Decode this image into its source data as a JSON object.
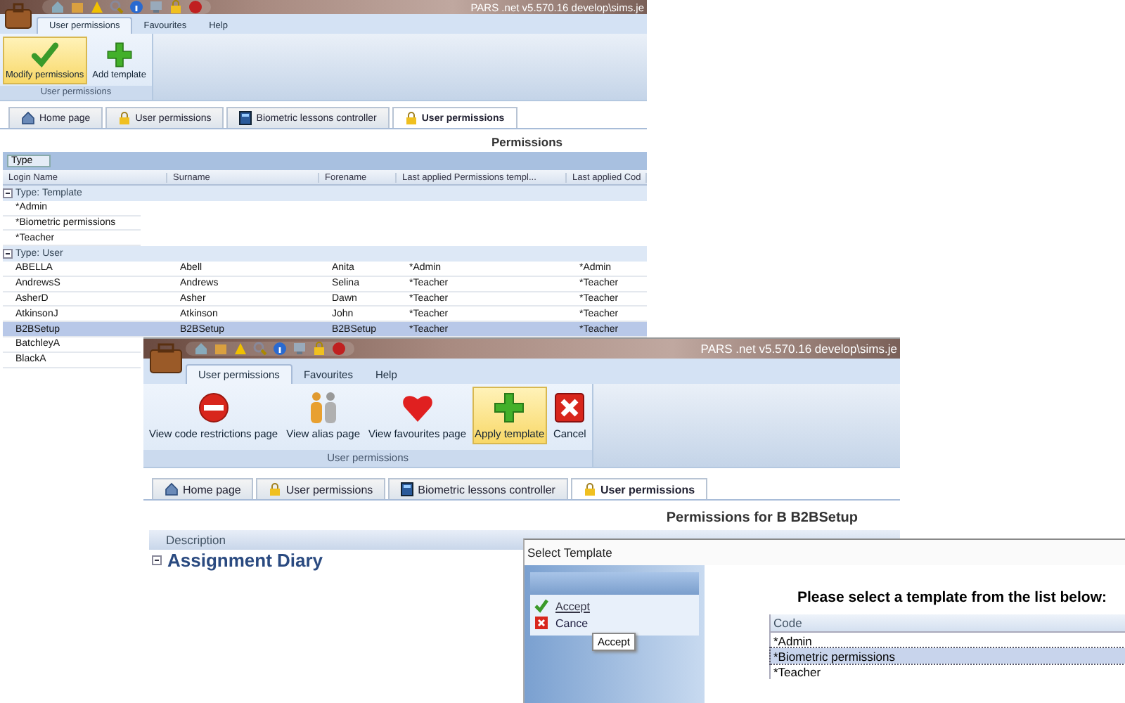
{
  "permissions_window": {
    "title": "PARS .net v5.570.16  develop\\sims.je",
    "ribbon_tabs": [
      {
        "label": "User permissions",
        "selected": true
      },
      {
        "label": "Favourites",
        "selected": false
      },
      {
        "label": "Help",
        "selected": false
      }
    ],
    "ribbon_buttons": [
      {
        "label": "Modify permissions",
        "kind": "check",
        "highlighted": true
      },
      {
        "label": "Add template",
        "kind": "plus",
        "highlighted": false
      }
    ],
    "ribbon_group_label": "User permissions",
    "document_tabs": [
      {
        "label": "Home page",
        "kind": "home",
        "selected": false
      },
      {
        "label": "User permissions",
        "kind": "lock",
        "selected": false
      },
      {
        "label": "Biometric lessons controller",
        "kind": "book",
        "selected": false
      },
      {
        "label": "User permissions",
        "kind": "lock",
        "selected": true
      }
    ],
    "heading": "Permissions",
    "group_by": "Type",
    "table": {
      "columns": [
        "Login Name",
        "Surname",
        "Forename",
        "Last applied Permissions templ...",
        "Last applied Cod"
      ],
      "groups": [
        {
          "label": "Type: Template",
          "expanded": true,
          "rows": [
            {
              "cells": [
                "*Admin"
              ],
              "selected": false
            },
            {
              "cells": [
                "*Biometric permissions"
              ],
              "selected": false
            },
            {
              "cells": [
                "*Teacher"
              ],
              "selected": false
            }
          ]
        },
        {
          "label": "Type: User",
          "expanded": true,
          "rows": [
            {
              "cells": [
                "ABELLA",
                "Abell",
                "Anita",
                "*Admin",
                "*Admin"
              ],
              "selected": false
            },
            {
              "cells": [
                "AndrewsS",
                "Andrews",
                "Selina",
                "*Teacher",
                "*Teacher"
              ],
              "selected": false
            },
            {
              "cells": [
                "AsherD",
                "Asher",
                "Dawn",
                "*Teacher",
                "*Teacher"
              ],
              "selected": false
            },
            {
              "cells": [
                "AtkinsonJ",
                "Atkinson",
                "John",
                "*Teacher",
                "*Teacher"
              ],
              "selected": false
            },
            {
              "cells": [
                "B2BSetup",
                "B2BSetup",
                "B2BSetup",
                "*Teacher",
                "*Teacher"
              ],
              "selected": true
            },
            {
              "cells": [
                "BatchleyA"
              ],
              "selected": false
            },
            {
              "cells": [
                "BlackA"
              ],
              "selected": false
            }
          ]
        }
      ]
    }
  },
  "user_window": {
    "title": "PARS .net v5.570.16  develop\\sims.je",
    "ribbon_tabs": [
      {
        "label": "User permissions",
        "selected": true
      },
      {
        "label": "Favourites",
        "selected": false
      },
      {
        "label": "Help",
        "selected": false
      }
    ],
    "ribbon_buttons": [
      {
        "label": "View code restrictions page",
        "kind": "no-entry",
        "highlighted": false
      },
      {
        "label": "View alias page",
        "kind": "people",
        "highlighted": false
      },
      {
        "label": "View favourites page",
        "kind": "heart",
        "highlighted": false
      },
      {
        "label": "Apply template",
        "kind": "plus",
        "highlighted": true
      },
      {
        "label": "Cancel",
        "kind": "cancel",
        "highlighted": false
      }
    ],
    "ribbon_group_label": "User permissions",
    "document_tabs": [
      {
        "label": "Home page",
        "kind": "home",
        "selected": false
      },
      {
        "label": "User permissions",
        "kind": "lock",
        "selected": false
      },
      {
        "label": "Biometric lessons controller",
        "kind": "book",
        "selected": false
      },
      {
        "label": "User permissions",
        "kind": "lock",
        "selected": true
      }
    ],
    "heading": "Permissions for B B2BSetup",
    "column": "Description",
    "section": {
      "label": "Assignment Diary",
      "expanded": true
    }
  },
  "select_template_dialog": {
    "title": "Select Template",
    "actions": [
      {
        "label": "Accept",
        "kind": "accept"
      },
      {
        "label": "Cance",
        "kind": "cancel"
      }
    ],
    "tooltip": "Accept",
    "prompt": "Please select a template from the list below:",
    "list": {
      "column": "Code",
      "rows": [
        {
          "label": "*Admin",
          "selected": false
        },
        {
          "label": "*Biometric permissions",
          "selected": true
        },
        {
          "label": "*Teacher",
          "selected": false
        }
      ]
    }
  }
}
